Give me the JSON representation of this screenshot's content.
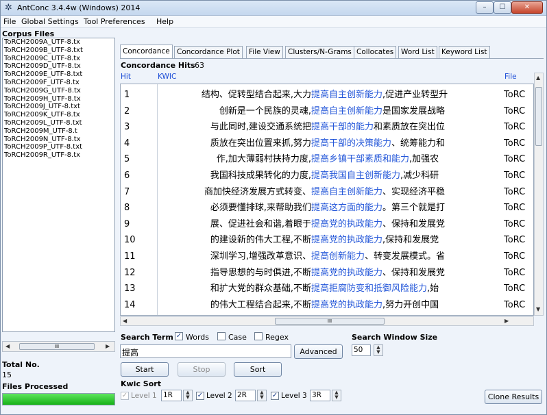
{
  "window": {
    "title": "AntConc 3.4.4w (Windows) 2014",
    "minimize": "–",
    "maximize": "☐",
    "close": "✕"
  },
  "menu": [
    "File",
    "Global Settings",
    "Tool Preferences",
    "Help"
  ],
  "corpus": {
    "title": "Corpus Files",
    "files": [
      "ToRCH2009A_UTF-8.tx",
      "ToRCH2009B_UTF-8.txt",
      "ToRCH2009C_UTF-8.tx",
      "ToRCH2009D_UTF-8.tx",
      "ToRCH2009E_UTF-8.txt",
      "ToRCH2009F_UTF-8.tx",
      "ToRCH2009G_UTF-8.tx",
      "ToRCH2009H_UTF-8.tx",
      "ToRCH2009J_UTF-8.txt",
      "ToRCH2009K_UTF-8.tx",
      "ToRCH2009L_UTF-8.txt",
      "ToRCH2009M_UTF-8.t",
      "ToRCH2009N_UTF-8.tx",
      "ToRCH2009P_UTF-8.txt",
      "ToRCH2009R_UTF-8.tx"
    ],
    "scroll_thumb": "III",
    "total_label": "Total No.",
    "total_value": "15",
    "processed_label": "Files Processed",
    "processed_fraction": 1.0
  },
  "tabs": [
    "Concordance",
    "Concordance Plot",
    "File View",
    "Clusters/N-Grams",
    "Collocates",
    "Word List",
    "Keyword List"
  ],
  "active_tab": "Concordance",
  "hits": {
    "label": "Concordance Hits",
    "value": "63"
  },
  "columns": {
    "hit": "Hit",
    "kwic": "KWIC",
    "file": "File"
  },
  "rows": [
    {
      "hit": "1",
      "left": "结构、促转型结合起来,大力",
      "node": "提高自主创新能力",
      "right": ",促进产业转型升",
      "file": "ToRC"
    },
    {
      "hit": "2",
      "left": "创新是一个民族的灵魂,",
      "node": "提高自主创新能力",
      "right": "是国家发展战略",
      "file": "ToRC"
    },
    {
      "hit": "3",
      "left": "与此同时,建设交通系统把",
      "node": "提高干部的能力",
      "right": "和素质放在突出位",
      "file": "ToRC"
    },
    {
      "hit": "4",
      "left": "质放在突出位置来抓,努力",
      "node": "提高干部的决策能力",
      "right": "、统筹能力和",
      "file": "ToRC"
    },
    {
      "hit": "5",
      "left": "作,加大薄弱村扶持力度,",
      "node": "提高乡镇干部素质和能力",
      "right": ",加强农",
      "file": "ToRC"
    },
    {
      "hit": "6",
      "left": "我国科技成果转化的力度,",
      "node": "提高我国自主创新能力",
      "right": ",减少科研",
      "file": "ToRC"
    },
    {
      "hit": "7",
      "left": "商加快经济发展方式转变、",
      "node": "提高自主创新能力",
      "right": "、实现经济平稳",
      "file": "ToRC"
    },
    {
      "hit": "8",
      "left": "必须要懂排球,来帮助我们",
      "node": "提高这方面的能力",
      "right": "。第三个就是打",
      "file": "ToRC"
    },
    {
      "hit": "9",
      "left": "展、促进社会和谐,着眼于",
      "node": "提高党的执政能力",
      "right": "、保持和发展党",
      "file": "ToRC"
    },
    {
      "hit": "10",
      "left": "的建设新的伟大工程,不断",
      "node": "提高党的执政能力",
      "right": ",保持和发展党",
      "file": "ToRC"
    },
    {
      "hit": "11",
      "left": "深圳学习,增强改革意识、",
      "node": "提高创新能力",
      "right": "、转变发展模式。省",
      "file": "ToRC"
    },
    {
      "hit": "12",
      "left": "指导思想的与时俱进,不断",
      "node": "提高党的执政能力",
      "right": "、保持和发展党",
      "file": "ToRC"
    },
    {
      "hit": "13",
      "left": "和扩大党的群众基础,不断",
      "node": "提高拒腐防变和抵御风险能力",
      "right": ",始",
      "file": "ToRC"
    },
    {
      "hit": "14",
      "left": "的伟大工程结合起来,不断",
      "node": "提高党的执政能力",
      "right": ",努力开创中国",
      "file": "ToRC"
    }
  ],
  "kwic_scroll_thumb": "III",
  "search": {
    "term_label": "Search Term",
    "words_label": "Words",
    "case_label": "Case",
    "regex_label": "Regex",
    "words_checked": true,
    "case_checked": false,
    "regex_checked": false,
    "value": "提高",
    "advanced_label": "Advanced",
    "window_label": "Search Window Size",
    "window_value": "50"
  },
  "buttons": {
    "start": "Start",
    "stop": "Stop",
    "sort": "Sort",
    "clone": "Clone Results"
  },
  "kwic_sort": {
    "label": "Kwic Sort",
    "levels": [
      {
        "label": "Level 1",
        "value": "1R",
        "checked": true,
        "enabled": false
      },
      {
        "label": "Level 2",
        "value": "2R",
        "checked": true,
        "enabled": true
      },
      {
        "label": "Level 3",
        "value": "3R",
        "checked": true,
        "enabled": true
      }
    ]
  }
}
